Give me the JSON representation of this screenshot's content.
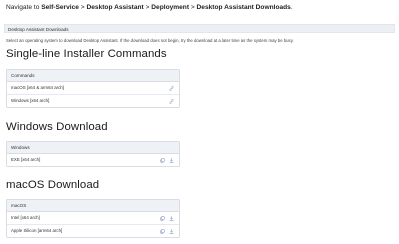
{
  "nav": {
    "prefix": "Navigate to ",
    "crumbs": [
      "Self-Service",
      "Desktop Assistant",
      "Deployment",
      "Desktop Assistant Downloads"
    ],
    "separator": " > ",
    "suffix": "."
  },
  "section": {
    "title": "Desktop Assistant Downloads",
    "intro": "Select an operating system to download Desktop Assistant. If the download does not begin, try the download at a later time as the system may be busy."
  },
  "installer": {
    "heading": "Single-line Installer Commands",
    "header": "Commands",
    "rows": [
      {
        "label": "macOS [x64 & arm64 arch]",
        "icon": "link-icon"
      },
      {
        "label": "Windows [x64 arch]",
        "icon": "link-icon"
      }
    ]
  },
  "windows": {
    "heading": "Windows Download",
    "header": "Windows",
    "rows": [
      {
        "label": "EXE [x64 arch]",
        "icons": [
          "copy-icon",
          "download-icon"
        ]
      }
    ]
  },
  "macos": {
    "heading": "macOS Download",
    "header": "macOS",
    "rows": [
      {
        "label": "Intel [x64 arch]",
        "icons": [
          "copy-icon",
          "download-icon"
        ]
      },
      {
        "label": "Apple Silicon [arm64 arch]",
        "icons": [
          "copy-icon",
          "download-icon"
        ]
      }
    ]
  },
  "colors": {
    "icon": "#6a7fb3",
    "header_bg": "#eef1f5",
    "border": "#d9dde3"
  }
}
